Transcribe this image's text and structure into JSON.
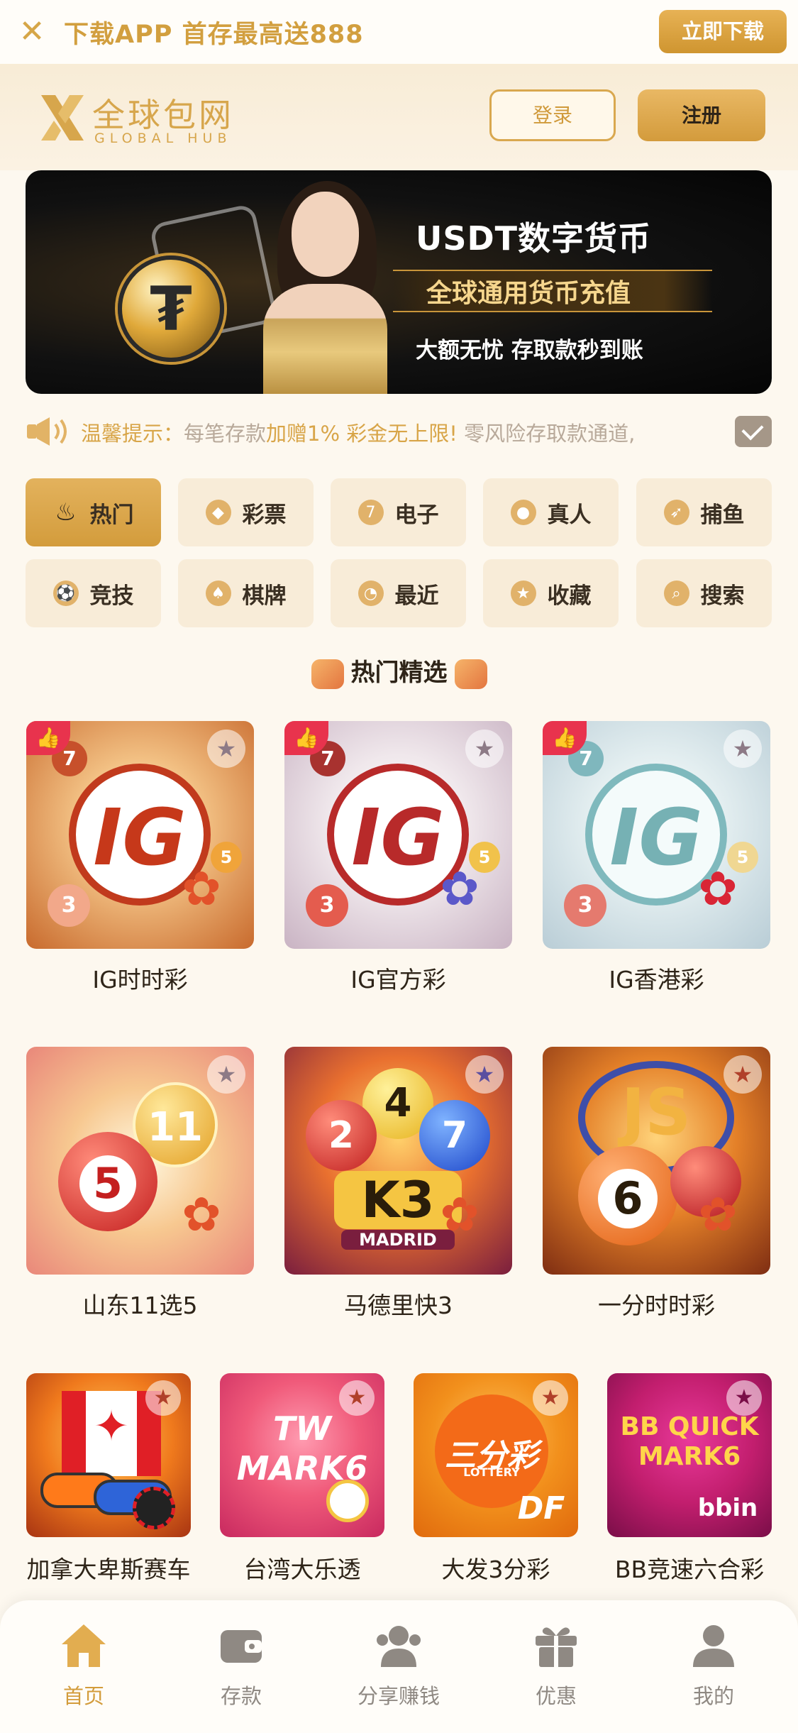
{
  "download_bar": {
    "close_icon": "close-icon",
    "text": "下载APP 首存最高送888",
    "button": "立即下载"
  },
  "header": {
    "logo_cn": "全球包网",
    "logo_en": "GLOBAL HUB",
    "login": "登录",
    "register": "注册"
  },
  "banner": {
    "title": "USDT数字货币",
    "subtitle": "全球通用货币充值",
    "line": "大额无忧 存取款秒到账"
  },
  "notice": {
    "prefix": "温馨提示：",
    "part1": "每笔存款",
    "part2": "加赠1% 彩金无上限!",
    "part3": " 零风险存取款通道,",
    "icon": "speaker-icon",
    "mail_icon": "mail-icon"
  },
  "categories": [
    {
      "label": "热门",
      "icon": "flame-icon",
      "glyph": "♨",
      "active": true
    },
    {
      "label": "彩票",
      "icon": "lottery-icon",
      "glyph": "◆",
      "active": false
    },
    {
      "label": "电子",
      "icon": "slot-icon",
      "glyph": "7",
      "active": false
    },
    {
      "label": "真人",
      "icon": "chip-icon",
      "glyph": "●",
      "active": false
    },
    {
      "label": "捕鱼",
      "icon": "fish-icon",
      "glyph": "➶",
      "active": false
    },
    {
      "label": "竞技",
      "icon": "soccer-icon",
      "glyph": "⚽",
      "active": false
    },
    {
      "label": "棋牌",
      "icon": "cards-icon",
      "glyph": "♠",
      "active": false
    },
    {
      "label": "最近",
      "icon": "clock-icon",
      "glyph": "◔",
      "active": false
    },
    {
      "label": "收藏",
      "icon": "star-icon",
      "glyph": "★",
      "active": false
    },
    {
      "label": "搜索",
      "icon": "search-icon",
      "glyph": "⌕",
      "active": false
    }
  ],
  "section_title": "热门精选",
  "games_row1": [
    {
      "name": "IG时时彩",
      "logo": "IG"
    },
    {
      "name": "IG官方彩",
      "logo": "IG"
    },
    {
      "name": "IG香港彩",
      "logo": "IG"
    }
  ],
  "games_row2": [
    {
      "name": "山东11选5",
      "logo": "11"
    },
    {
      "name": "马德里快3",
      "logo": "K3",
      "sub": "MADRID"
    },
    {
      "name": "一分时时彩",
      "logo": "JS"
    }
  ],
  "games_row3": [
    {
      "name": "加拿大卑斯赛车"
    },
    {
      "name": "台湾大乐透",
      "logo": "TW MARK6"
    },
    {
      "name": "大发3分彩",
      "logo": "三分彩",
      "sub": "LOTTERY"
    },
    {
      "name": "BB竞速六合彩",
      "logo": "BB QUICK MARK6"
    }
  ],
  "nav": [
    {
      "label": "首页",
      "icon": "home-icon",
      "active": true
    },
    {
      "label": "存款",
      "icon": "wallet-icon",
      "active": false
    },
    {
      "label": "分享赚钱",
      "icon": "share-users-icon",
      "active": false
    },
    {
      "label": "优惠",
      "icon": "gift-icon",
      "active": false
    },
    {
      "label": "我的",
      "icon": "profile-icon",
      "active": false
    }
  ]
}
